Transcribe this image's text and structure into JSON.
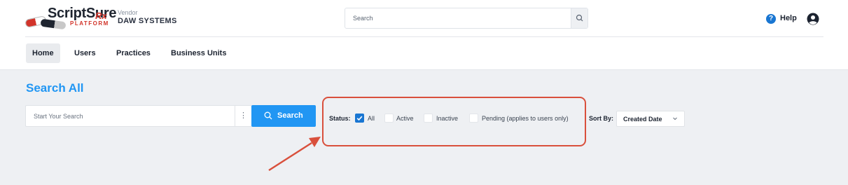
{
  "header": {
    "logo_text": "ScriptSure",
    "logo_rx": "Rx",
    "logo_platform": "PLATFORM",
    "vendor_label": "Vendor",
    "vendor_name": "DAW SYSTEMS",
    "search_placeholder": "Search",
    "help_label": "Help"
  },
  "nav": {
    "items": [
      {
        "label": "Home",
        "active": true
      },
      {
        "label": "Users",
        "active": false
      },
      {
        "label": "Practices",
        "active": false
      },
      {
        "label": "Business Units",
        "active": false
      }
    ]
  },
  "main": {
    "title": "Search All",
    "search_placeholder": "Start Your Search",
    "kebab": "⋮",
    "search_button": "Search",
    "status_label": "Status:",
    "status_options": [
      {
        "label": "All",
        "checked": true
      },
      {
        "label": "Active",
        "checked": false
      },
      {
        "label": "Inactive",
        "checked": false
      },
      {
        "label": "Pending (applies to users only)",
        "checked": false
      }
    ],
    "sort_label": "Sort By:",
    "sort_value": "Created Date"
  },
  "colors": {
    "accent": "#2196f3",
    "checkbox": "#1976d2",
    "annotation": "#d9503c"
  }
}
